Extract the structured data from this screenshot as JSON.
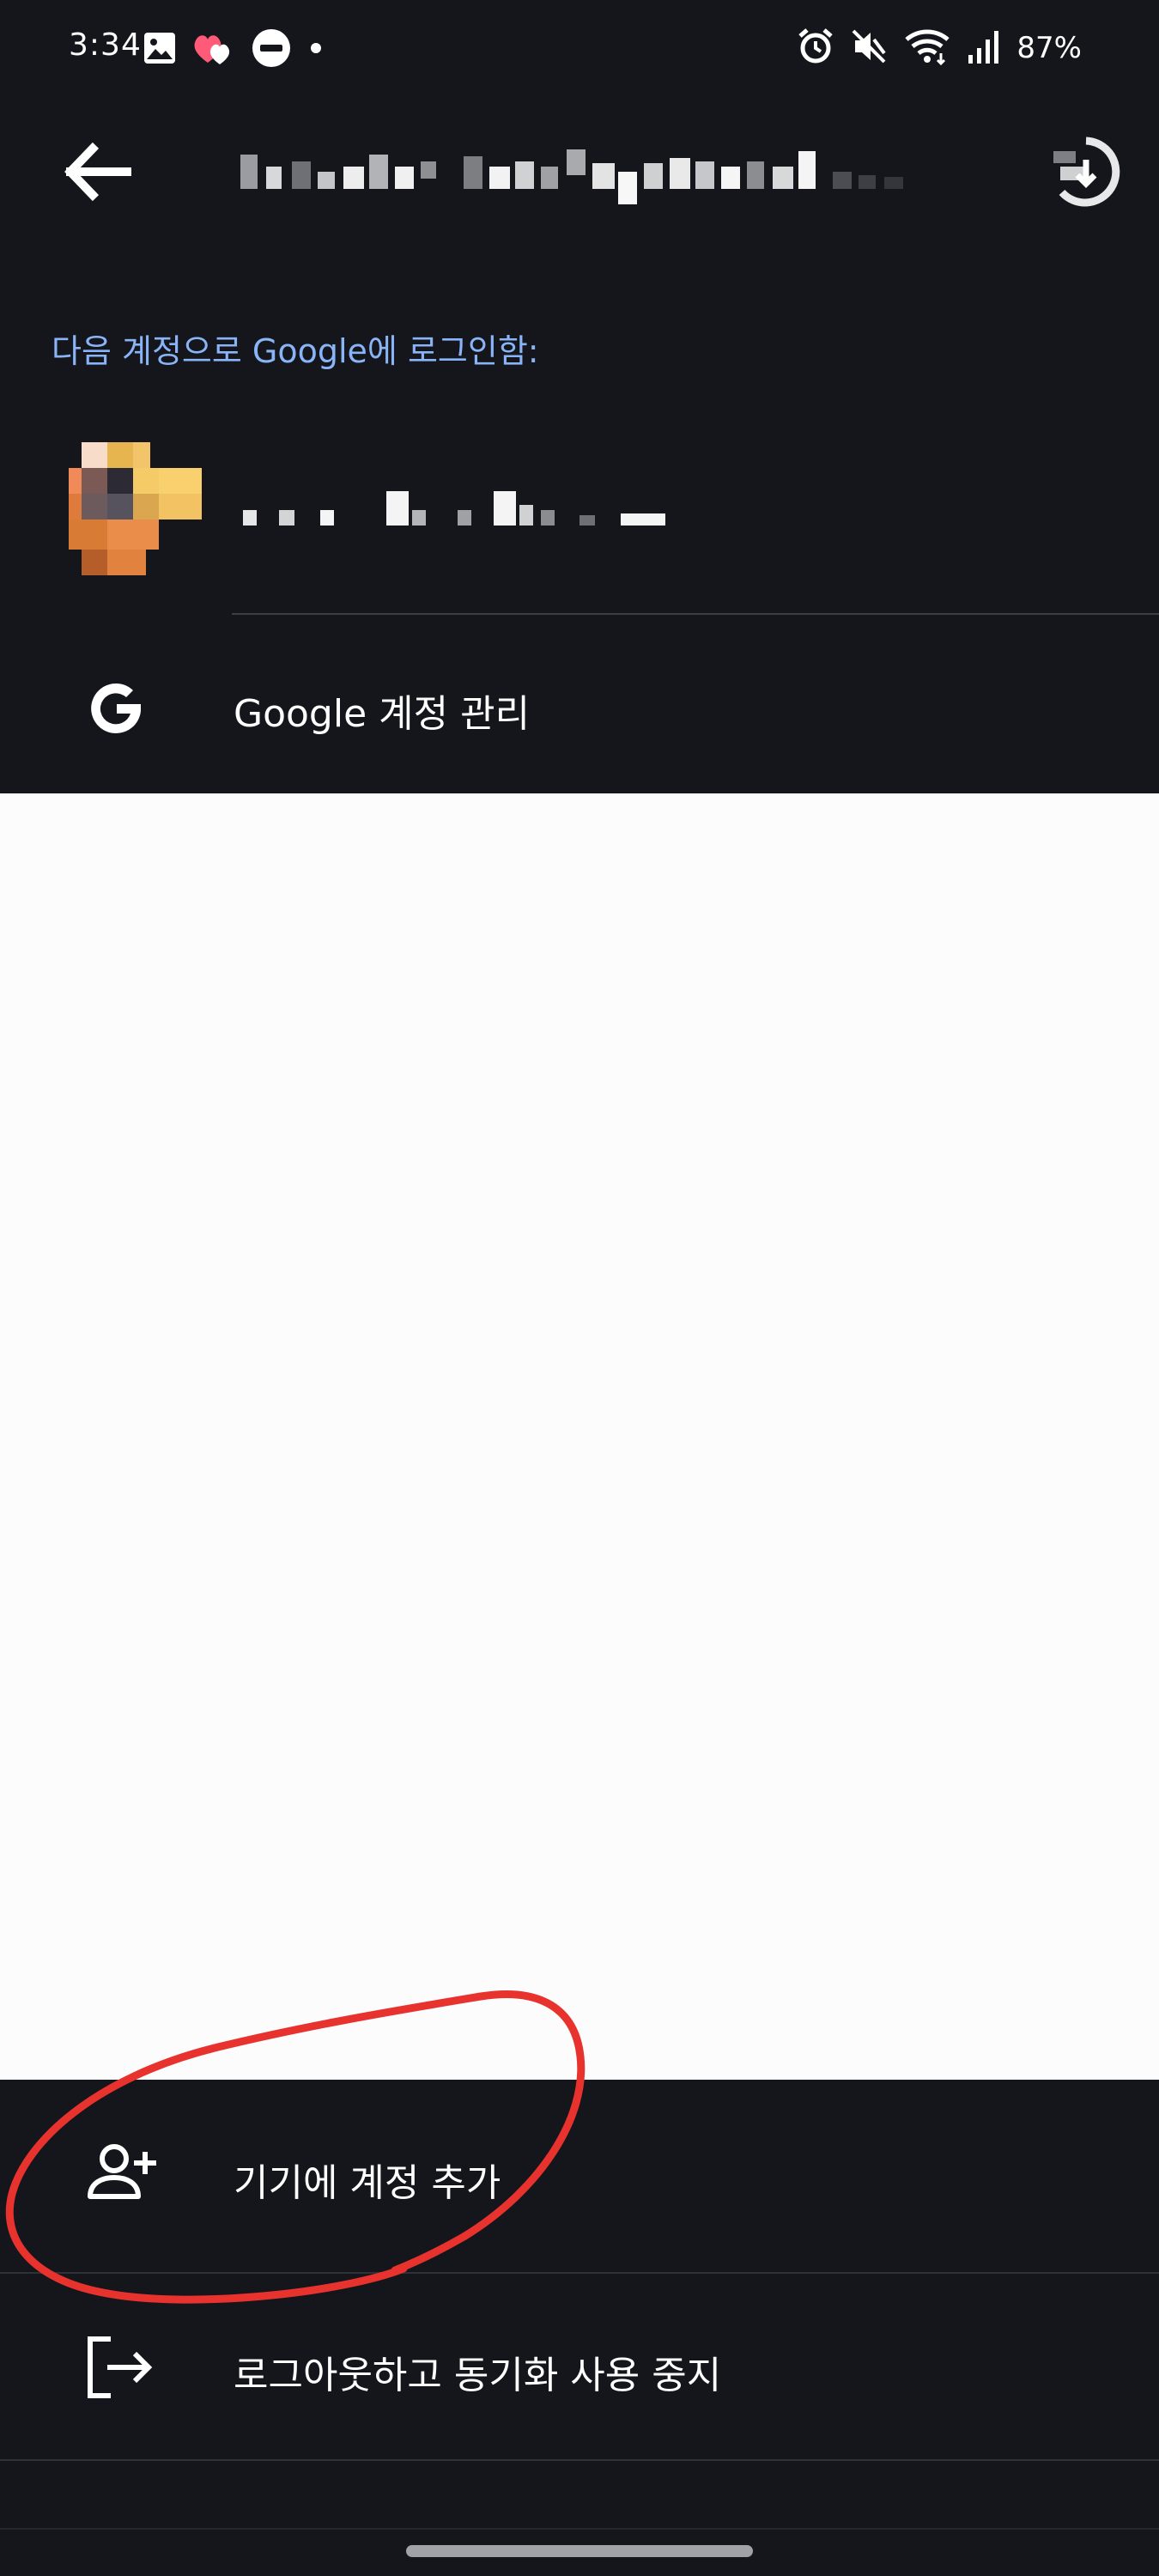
{
  "status_bar": {
    "time": "3:34",
    "battery": "87%",
    "left_icons": [
      "gallery-icon",
      "heart-icon",
      "do-not-disturb-icon",
      "dot-icon"
    ],
    "right_icons": [
      "alarm-icon",
      "mute-icon",
      "wifi-icon",
      "signal-icon"
    ]
  },
  "app_bar": {
    "back_icon": "arrow-back-icon",
    "account_email": "",
    "switch_icon": "switch-account-icon"
  },
  "signed_in_label": "다음 계정으로 Google에 로그인함:",
  "account": {
    "name": "",
    "avatar": "avatar"
  },
  "manage_account": {
    "icon": "google-g-icon",
    "label": "Google 계정 관리"
  },
  "actions": {
    "add_account": {
      "icon": "person-add-icon",
      "label": "기기에 계정 추가"
    },
    "sign_out": {
      "icon": "logout-icon",
      "label": "로그아웃하고 동기화 사용 중지"
    }
  },
  "colors": {
    "background": "#14161b",
    "accent_blue": "#8ab4f8",
    "content_white": "#fcfcfc",
    "annotation_red": "#e8322d"
  }
}
